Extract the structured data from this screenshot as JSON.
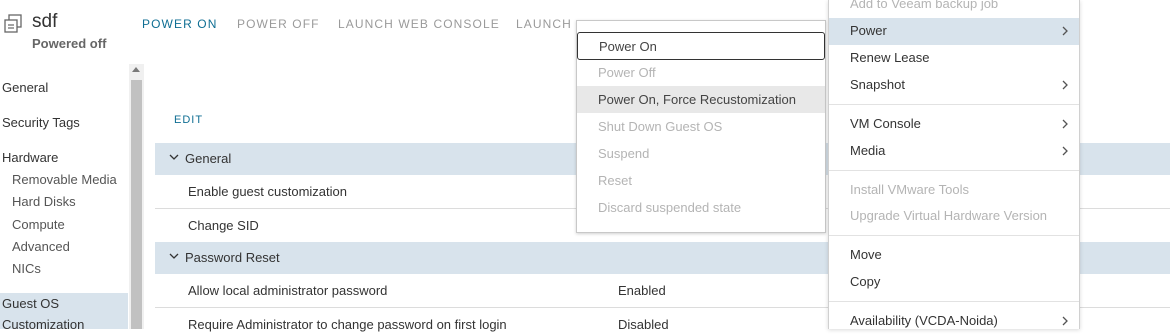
{
  "header": {
    "vm_name": "sdf",
    "vm_state": "Powered off",
    "actions": [
      "POWER ON",
      "POWER OFF",
      "LAUNCH WEB CONSOLE",
      "LAUNCH"
    ]
  },
  "sidebar": {
    "items": [
      "General",
      "Security Tags",
      "Hardware"
    ],
    "hardware_items": [
      "Removable Media",
      "Hard Disks",
      "Compute",
      "Advanced",
      "NICs"
    ],
    "selected": [
      "Guest OS",
      "Customization"
    ]
  },
  "main": {
    "edit_label": "EDIT",
    "sections": [
      {
        "title": "General",
        "rows": [
          {
            "label": "Enable guest customization",
            "value": ""
          },
          {
            "label": "Change SID",
            "value": ""
          }
        ]
      },
      {
        "title": "Password Reset",
        "rows": [
          {
            "label": "Allow local administrator password",
            "value": "Enabled"
          },
          {
            "label": "Require Administrator to change password on first login",
            "value": "Disabled"
          }
        ]
      }
    ]
  },
  "power_submenu": {
    "items": [
      {
        "label": "Power On",
        "enabled": true
      },
      {
        "label": "Power Off",
        "enabled": false
      },
      {
        "label": "Power On, Force Recustomization",
        "enabled": true
      },
      {
        "label": "Shut Down Guest OS",
        "enabled": false
      },
      {
        "label": "Suspend",
        "enabled": false
      },
      {
        "label": "Reset",
        "enabled": false
      },
      {
        "label": "Discard suspended state",
        "enabled": false
      }
    ]
  },
  "context_menu": {
    "items": [
      {
        "label": "Add to Veeam backup job",
        "enabled": false
      },
      {
        "label": "Power",
        "enabled": true,
        "submenu": true
      },
      {
        "label": "Renew Lease",
        "enabled": true
      },
      {
        "label": "Snapshot",
        "enabled": true,
        "submenu": true
      },
      {
        "label": "VM Console",
        "enabled": true,
        "submenu": true
      },
      {
        "label": "Media",
        "enabled": true,
        "submenu": true
      },
      {
        "label": "Install VMware Tools",
        "enabled": false
      },
      {
        "label": "Upgrade Virtual Hardware Version",
        "enabled": false
      },
      {
        "label": "Move",
        "enabled": true
      },
      {
        "label": "Copy",
        "enabled": true
      },
      {
        "label": "Availability (VCDA-Noida)",
        "enabled": true,
        "submenu": true
      }
    ]
  },
  "colors": {
    "accent": "#0f6e93",
    "section_bg": "#d8e3ec",
    "disabled_text": "#b4b4b4"
  },
  "icons": {
    "vm": "vm-icon",
    "chevron_down": "chevron-down-icon",
    "chevron_right": "chevron-right-icon"
  }
}
